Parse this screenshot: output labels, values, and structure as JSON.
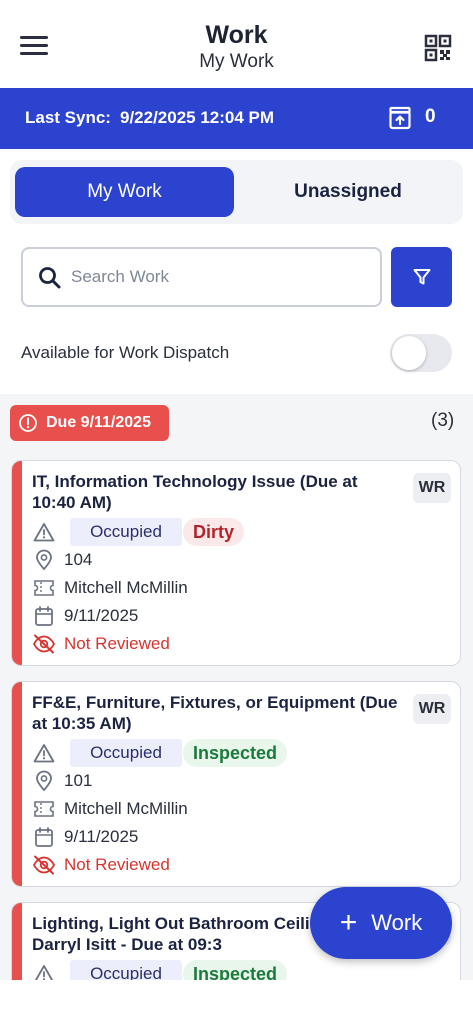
{
  "header": {
    "title": "Work",
    "subtitle": "My Work"
  },
  "sync": {
    "label": "Last Sync:",
    "value": "9/22/2025 12:04 PM",
    "pending_count": "0"
  },
  "tabs": [
    {
      "label": "My Work",
      "active": true
    },
    {
      "label": "Unassigned",
      "active": false
    }
  ],
  "search": {
    "placeholder": "Search Work",
    "value": ""
  },
  "dispatch": {
    "label": "Available for Work Dispatch",
    "enabled": false
  },
  "group": {
    "due_label": "Due 9/11/2025",
    "count": "(3)"
  },
  "cards": [
    {
      "title": "IT, Information Technology Issue (Due at 10:40 AM)",
      "type": "WR",
      "occupancy": "Occupied",
      "status": "Dirty",
      "room": "104",
      "assignee": "Mitchell McMillin",
      "date": "9/11/2025",
      "review": "Not Reviewed"
    },
    {
      "title": "FF&E, Furniture, Fixtures, or Equipment (Due at 10:35 AM)",
      "type": "WR",
      "occupancy": "Occupied",
      "status": "Inspected",
      "room": "101",
      "assignee": "Mitchell McMillin",
      "date": "9/11/2025",
      "review": "Not Reviewed"
    },
    {
      "title": "Lighting, Light Out Bathroom Ceili Issue (Mr. Darryl Isitt  - Due at 09:3",
      "type": "WR",
      "occupancy": "Occupied",
      "status": "Inspected"
    }
  ],
  "fab": {
    "plus": "+",
    "label": "Work"
  },
  "colors": {
    "primary": "#2c43d0",
    "overdue": "#e8504e",
    "dirty": "#b2242c",
    "inspected": "#1c7a3c"
  }
}
